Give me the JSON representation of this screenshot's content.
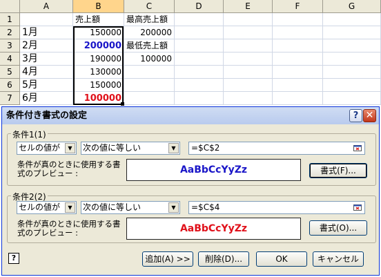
{
  "sheet": {
    "columns": [
      "A",
      "B",
      "C",
      "D",
      "E",
      "F",
      "G"
    ],
    "rows": [
      "1",
      "2",
      "3",
      "4",
      "5",
      "6",
      "7"
    ],
    "cells": {
      "B1": "売上額",
      "C1": "最高売上額",
      "A2": "1月",
      "B2": "150000",
      "C2": "200000",
      "A3": "2月",
      "B3": "200000",
      "C3": "最低売上額",
      "A4": "3月",
      "B4": "190000",
      "C4": "100000",
      "A5": "4月",
      "B5": "130000",
      "A6": "5月",
      "B6": "150000",
      "A7": "6月",
      "B7": "100000"
    },
    "selected_column": "B",
    "highlight_colors": {
      "max": "#1a16c8",
      "min": "#e0101a"
    }
  },
  "dialog": {
    "title": "条件付き書式の設定",
    "help_glyph": "?",
    "close_glyph": "✕",
    "conditions": [
      {
        "label": "条件1(1)",
        "type": "セルの値が",
        "operator": "次の値に等しい",
        "formula": "=$C$2",
        "preview_label": "条件が真のときに使用する書式のプレビュー :",
        "preview_text": "AaBbCcYyZz",
        "preview_color": "#1a16c8",
        "format_button": "書式(F)..."
      },
      {
        "label": "条件2(2)",
        "type": "セルの値が",
        "operator": "次の値に等しい",
        "formula": "=$C$4",
        "preview_label": "条件が真のときに使用する書式のプレビュー :",
        "preview_text": "AaBbCcYyZz",
        "preview_color": "#e0101a",
        "format_button": "書式(O)..."
      }
    ],
    "buttons": {
      "add": "追加(A) >>",
      "delete": "削除(D)...",
      "ok": "OK",
      "cancel": "キャンセル"
    },
    "help_icon_glyph": "?"
  }
}
